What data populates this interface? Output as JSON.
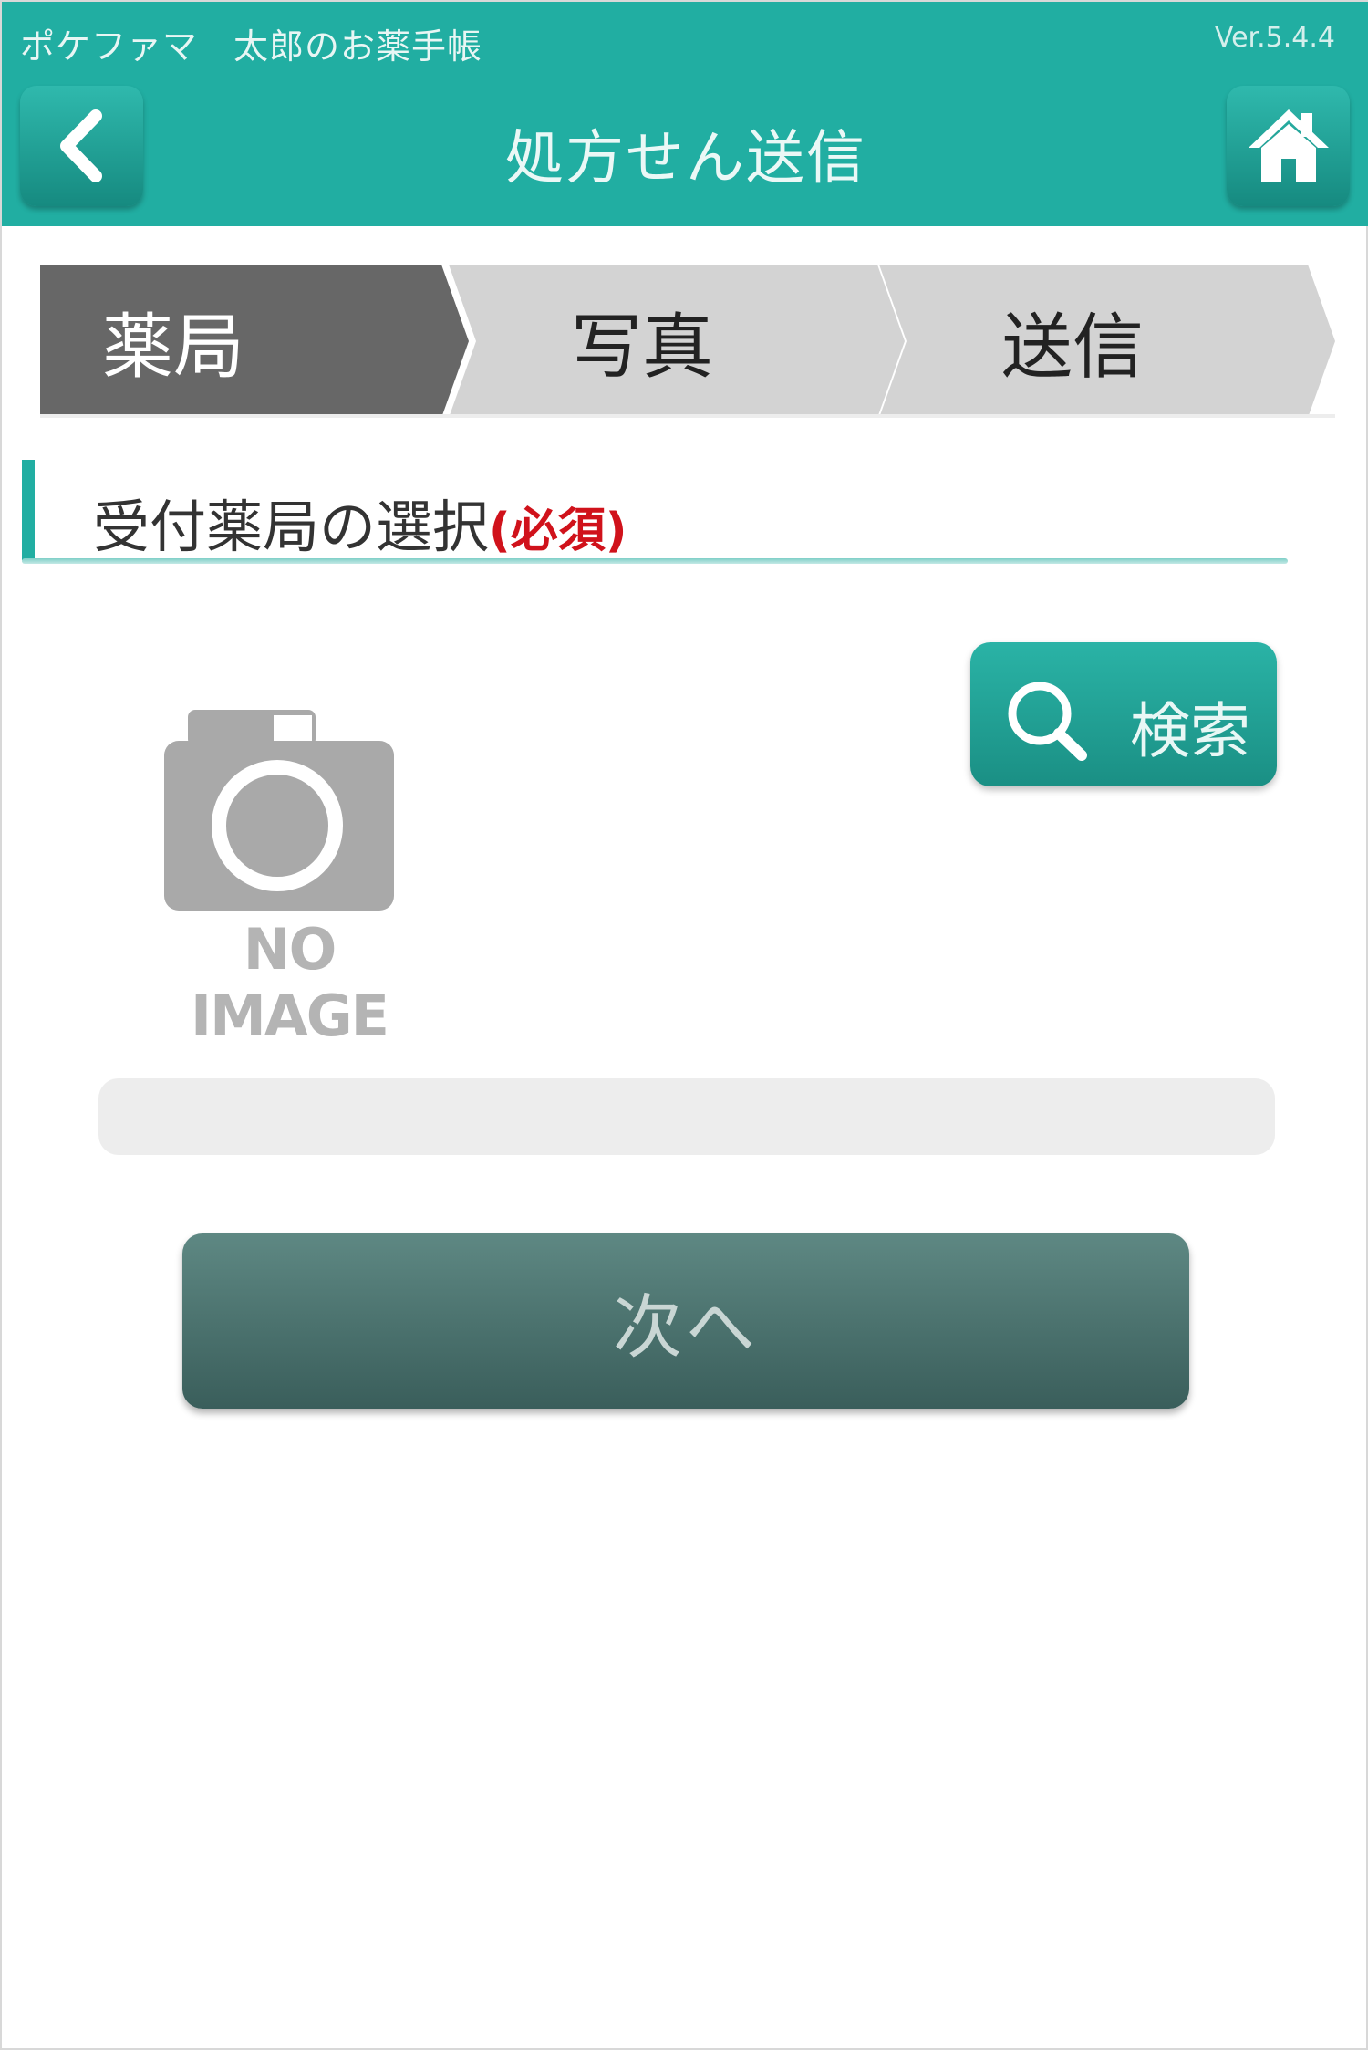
{
  "header": {
    "app_name": "ポケファマ　太郎のお薬手帳",
    "version": "Ver.5.4.4",
    "title": "処方せん送信",
    "back_icon": "chevron-left-icon",
    "home_icon": "home-icon"
  },
  "stepper": {
    "steps": [
      {
        "label": "薬局",
        "active": true
      },
      {
        "label": "写真",
        "active": false
      },
      {
        "label": "送信",
        "active": false
      }
    ]
  },
  "section": {
    "title": "受付薬局の選択",
    "required": "(必須)"
  },
  "search": {
    "label": "検索",
    "icon": "search-icon"
  },
  "pharmacy": {
    "image_placeholder": "NO IMAGE",
    "image_icon": "camera-icon",
    "name_value": ""
  },
  "actions": {
    "next_label": "次へ"
  },
  "colors": {
    "accent": "#21aea2",
    "active_step": "#676767",
    "inactive_step": "#d3d3d3",
    "required": "#d0121b",
    "next_button": "#4b706c"
  }
}
